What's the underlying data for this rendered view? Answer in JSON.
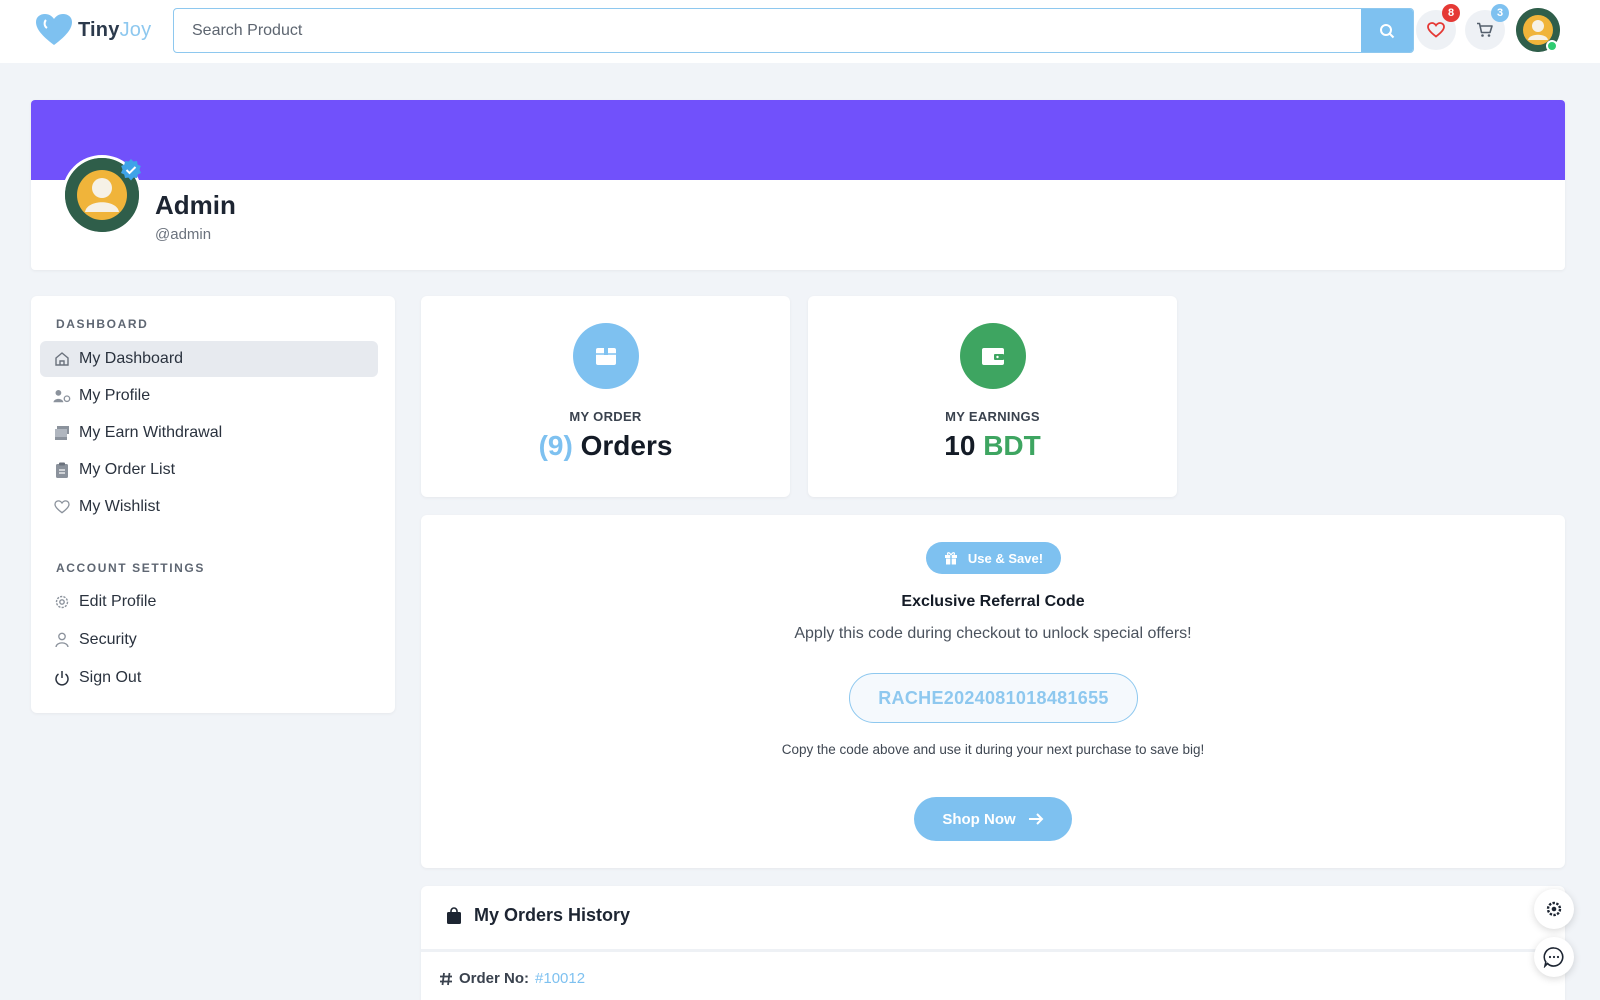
{
  "header": {
    "logo_part1": "Tiny",
    "logo_part2": "Joy",
    "search_placeholder": "Search Product",
    "wishlist_count": "8",
    "cart_count": "3"
  },
  "profile": {
    "name": "Admin",
    "handle": "@admin",
    "banner_color": "#7151fb"
  },
  "sidebar": {
    "dashboard_heading": "DASHBOARD",
    "dashboard_items": [
      {
        "label": "My Dashboard",
        "icon": "home-icon"
      },
      {
        "label": "My Profile",
        "icon": "user-settings-icon"
      },
      {
        "label": "My Earn Withdrawal",
        "icon": "money-icon"
      },
      {
        "label": "My Order List",
        "icon": "clipboard-icon"
      },
      {
        "label": "My Wishlist",
        "icon": "heart-icon"
      }
    ],
    "account_heading": "ACCOUNT SETTINGS",
    "account_items": [
      {
        "label": "Edit Profile",
        "icon": "gear-icon"
      },
      {
        "label": "Security",
        "icon": "user-icon"
      },
      {
        "label": "Sign Out",
        "icon": "power-icon"
      }
    ]
  },
  "stats": {
    "order_label": "MY ORDER",
    "order_count": "(9)",
    "order_unit": "Orders",
    "earnings_label": "MY EARNINGS",
    "earnings_value": "10",
    "earnings_unit": "BDT"
  },
  "referral": {
    "pill_label": "Use & Save!",
    "title": "Exclusive Referral Code",
    "subtitle": "Apply this code during checkout to unlock special offers!",
    "code": "RACHE2024081018481655",
    "note": "Copy the code above and use it during your next purchase to save big!",
    "button_label": "Shop Now"
  },
  "orders": {
    "title": "My Orders History",
    "order_label": "Order No:",
    "order_number": "#10012"
  },
  "colors": {
    "accent": "#7ec1f0",
    "earnings_green": "#3ea561",
    "badge_red": "#e53935"
  }
}
